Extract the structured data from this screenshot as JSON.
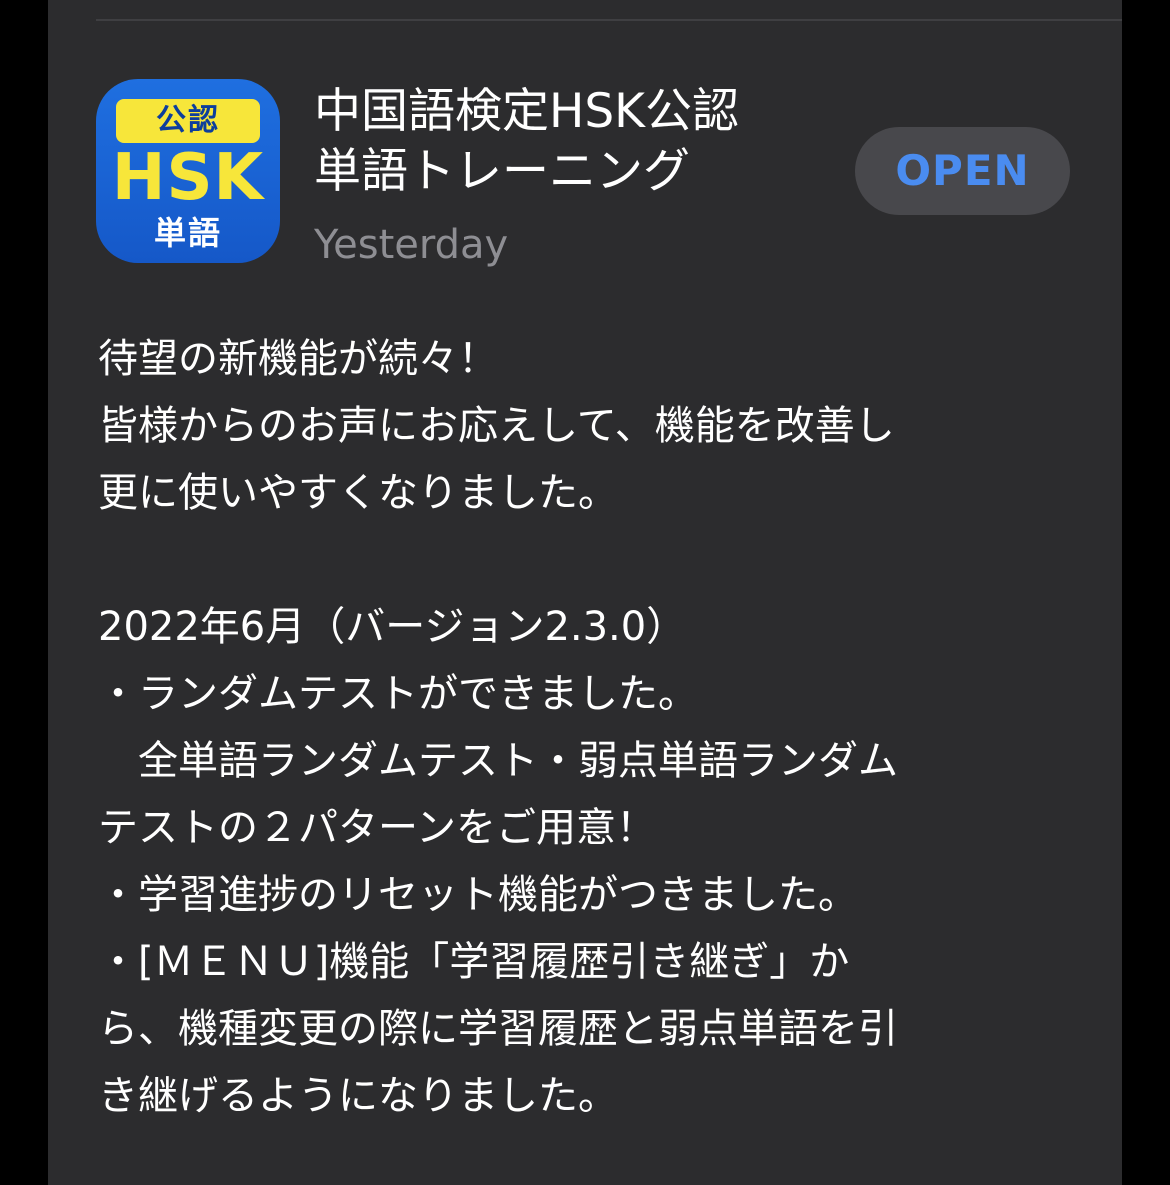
{
  "app": {
    "icon": {
      "badge_text": "公認",
      "main_text": "HSK",
      "sub_text": "単語",
      "colors": {
        "background": "#1a62d6",
        "badge": "#f7e63a",
        "text": "#f7e63a"
      }
    },
    "title_line1": "中国語検定HSK公認",
    "title_line2": "単語トレーニング",
    "date": "Yesterday",
    "open_label": "OPEN"
  },
  "notes": {
    "lines": [
      "待望の新機能が続々！",
      "皆様からのお声にお応えして、機能を改善し",
      "更に使いやすくなりました。",
      "",
      "2022年6月（バージョン2.3.0）",
      "・ランダムテストができました。",
      "　全単語ランダムテスト・弱点単語ランダム",
      "テストの２パターンをご用意！",
      "・学習進捗のリセット機能がつきました。",
      "・[ＭＥＮＵ]機能「学習履歴引き継ぎ」か",
      "ら、機種変更の際に学習履歴と弱点単語を引",
      "き継げるようになりました。"
    ]
  },
  "colors": {
    "page_background": "#000000",
    "card_background": "#2c2c2e",
    "accent": "#4a8cf0",
    "secondary_text": "#8e8e93"
  }
}
